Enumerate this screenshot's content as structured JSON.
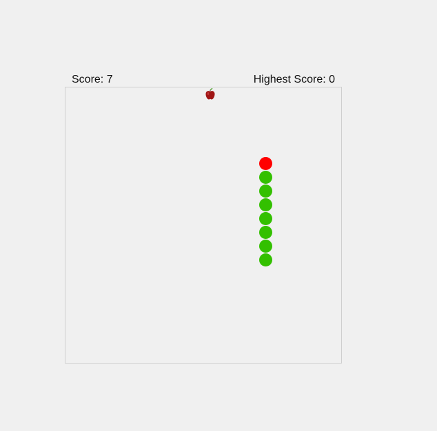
{
  "scoreboard": {
    "score_label": "Score: 7",
    "high_score_label": "Highest Score: 0"
  },
  "game": {
    "grid_size": 20,
    "apple": {
      "col": 10,
      "row": 0,
      "icon": "apple-icon"
    },
    "snake": {
      "head": {
        "col": 14,
        "row": 5
      },
      "body": [
        {
          "col": 14,
          "row": 6
        },
        {
          "col": 14,
          "row": 7
        },
        {
          "col": 14,
          "row": 8
        },
        {
          "col": 14,
          "row": 9
        },
        {
          "col": 14,
          "row": 10
        },
        {
          "col": 14,
          "row": 11
        },
        {
          "col": 14,
          "row": 12
        }
      ]
    }
  },
  "colors": {
    "head": "#ff0000",
    "body": "#33c000",
    "apple": "#a01515",
    "leaf": "#3c9a1a",
    "board_border": "#cfcfcf",
    "background": "#f0f0f0"
  }
}
